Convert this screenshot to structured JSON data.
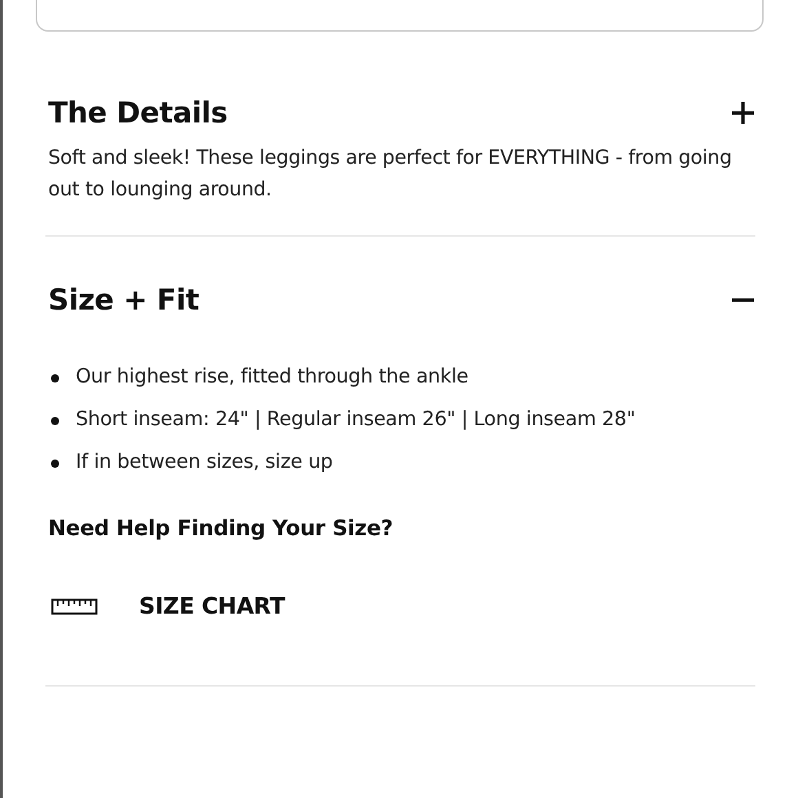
{
  "sections": [
    {
      "title": "The Details",
      "expanded": false,
      "summary": "Soft and sleek! These leggings are perfect for EVERYTHING - from going out to lounging around."
    },
    {
      "title": "Size + Fit",
      "expanded": true,
      "bullets": [
        "Our highest rise, fitted through the ankle",
        "Short inseam: 24\" | Regular inseam 26\" | Long inseam 28\"",
        "If in between sizes, size up"
      ],
      "help_heading": "Need Help Finding Your Size?",
      "size_chart_link": "SIZE CHART"
    }
  ]
}
